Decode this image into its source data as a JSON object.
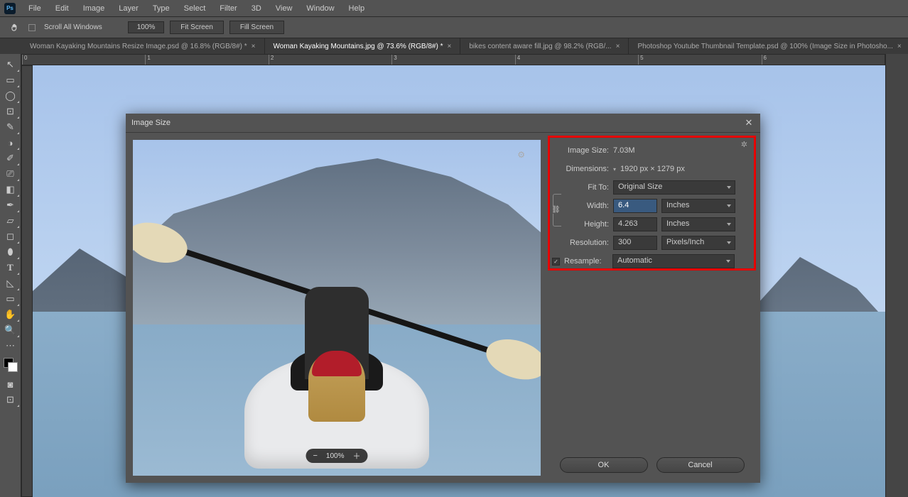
{
  "menubar": {
    "logo": "Ps",
    "items": [
      "File",
      "Edit",
      "Image",
      "Layer",
      "Type",
      "Select",
      "Filter",
      "3D",
      "View",
      "Window",
      "Help"
    ]
  },
  "optbar": {
    "scroll_label": "Scroll All Windows",
    "zoom": "100%",
    "fit_screen": "Fit Screen",
    "fill_screen": "Fill Screen"
  },
  "tabs": [
    {
      "label": "Woman Kayaking Mountains Resize Image.psd @ 16.8% (RGB/8#) *",
      "active": false
    },
    {
      "label": "Woman Kayaking Mountains.jpg @ 73.6% (RGB/8#) *",
      "active": true
    },
    {
      "label": "bikes content aware fill.jpg @ 98.2% (RGB/...",
      "active": false
    },
    {
      "label": "Photoshop Youtube Thumbnail Template.psd @ 100% (Image Size in Photosho...",
      "active": false
    }
  ],
  "ruler": {
    "marks": [
      "0",
      "1",
      "2",
      "3",
      "4",
      "5",
      "6"
    ]
  },
  "dialog": {
    "title": "Image Size",
    "image_size_label": "Image Size:",
    "image_size_value": "7.03M",
    "dimensions_label": "Dimensions:",
    "dimensions_value": "1920 px × 1279 px",
    "fit_to_label": "Fit To:",
    "fit_to_value": "Original Size",
    "width_label": "Width:",
    "width_value": "6.4",
    "width_unit": "Inches",
    "height_label": "Height:",
    "height_value": "4.263",
    "height_unit": "Inches",
    "resolution_label": "Resolution:",
    "resolution_value": "300",
    "resolution_unit": "Pixels/Inch",
    "resample_label": "Resample:",
    "resample_checked": true,
    "resample_value": "Automatic",
    "zoom": "100%",
    "ok": "OK",
    "cancel": "Cancel"
  },
  "tools": [
    "↖",
    "▣",
    "◑",
    "⊡",
    "⟋",
    "✎",
    "⎚",
    "✐",
    "⟋",
    "⊥",
    "✎",
    "◧",
    "⬚",
    "T",
    "◺",
    "✋",
    "⊕"
  ]
}
